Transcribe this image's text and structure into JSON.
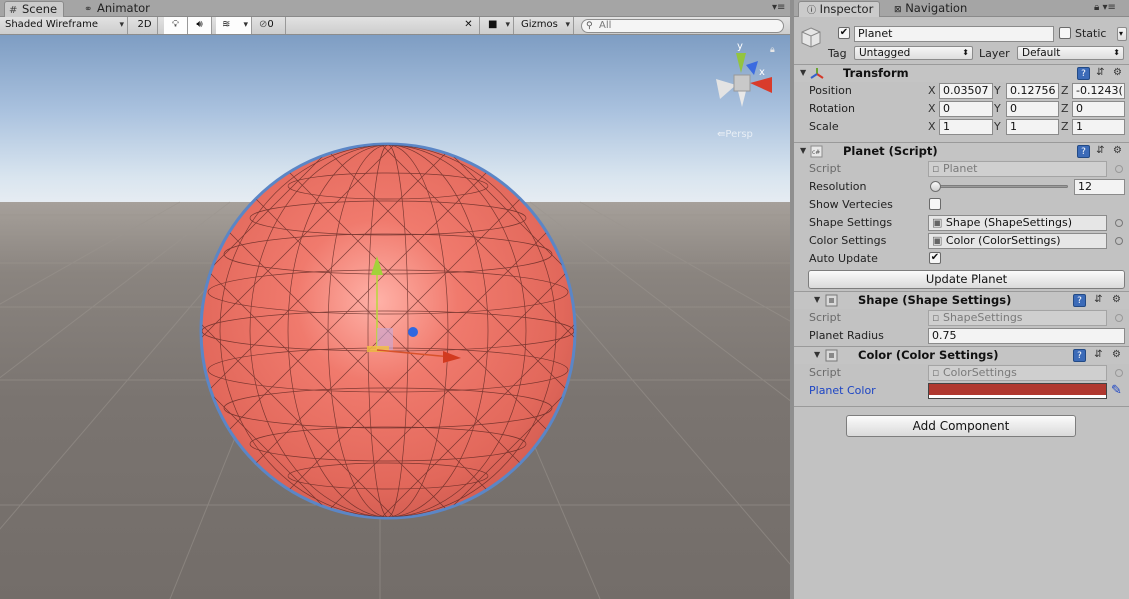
{
  "scene_window": {
    "tabs": [
      {
        "label": "Scene",
        "icon": "hash-grid-icon"
      },
      {
        "label": "Animator",
        "icon": "animator-icon"
      }
    ],
    "toolbar": {
      "shading_mode": "Shaded Wireframe",
      "mode_2d": "2D",
      "effects_count": "0",
      "gizmos_label": "Gizmos",
      "search_placeholder": "All"
    },
    "view_label": "Persp",
    "gizmo_axes": {
      "y": "y",
      "x": "x"
    }
  },
  "inspector": {
    "tabs": [
      {
        "label": "Inspector",
        "icon": "info-icon"
      },
      {
        "label": "Navigation",
        "icon": "navigation-icon"
      }
    ],
    "object": {
      "active": true,
      "name": "Planet",
      "static_label": "Static",
      "static_checked": false,
      "tag_label": "Tag",
      "tag_value": "Untagged",
      "layer_label": "Layer",
      "layer_value": "Default"
    },
    "transform": {
      "title": "Transform",
      "position_label": "Position",
      "rotation_label": "Rotation",
      "scale_label": "Scale",
      "position": {
        "x": "0.03507",
        "y": "0.12756",
        "z": "-0.1243("
      },
      "rotation": {
        "x": "0",
        "y": "0",
        "z": "0"
      },
      "scale": {
        "x": "1",
        "y": "1",
        "z": "1"
      },
      "axis_labels": {
        "x": "X",
        "y": "Y",
        "z": "Z"
      }
    },
    "planet_script": {
      "title": "Planet (Script)",
      "script_label": "Script",
      "script_value": "Planet",
      "resolution_label": "Resolution",
      "resolution_value": "12",
      "resolution_fraction": 0.0,
      "show_vertecies_label": "Show Vertecies",
      "show_vertecies_checked": false,
      "shape_settings_label": "Shape Settings",
      "shape_settings_value": "Shape (ShapeSettings)",
      "color_settings_label": "Color Settings",
      "color_settings_value": "Color (ColorSettings)",
      "auto_update_label": "Auto Update",
      "auto_update_checked": true,
      "update_button": "Update Planet"
    },
    "shape_settings": {
      "title": "Shape (Shape Settings)",
      "script_label": "Script",
      "script_value": "ShapeSettings",
      "radius_label": "Planet Radius",
      "radius_value": "0.75"
    },
    "color_settings": {
      "title": "Color (Color Settings)",
      "script_label": "Script",
      "script_value": "ColorSettings",
      "planet_color_label": "Planet Color",
      "planet_color": "#b0382f"
    },
    "add_component_button": "Add Component"
  },
  "colors": {
    "planet_fill": "#e86e62",
    "planet_highlight": "#ffb2a8",
    "selection_outline": "#5b86c6"
  }
}
